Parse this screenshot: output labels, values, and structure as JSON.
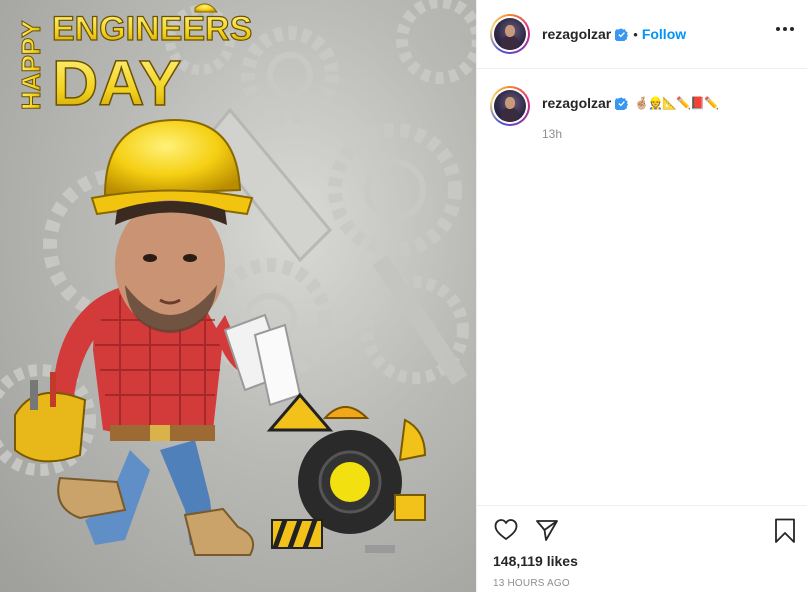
{
  "post": {
    "username": "rezagolzar",
    "follow_label": "Follow",
    "separator": "•",
    "caption_emojis": "🤞🏼👷📐✏️📕✏️",
    "caption_time": "13h",
    "likes_text": "148,119 likes",
    "posted_ago": "13 HOURS AGO"
  },
  "image": {
    "title_happy": "HAPPY",
    "title_engineers": "ENGINEERS",
    "title_day": "DAY"
  },
  "icons": {
    "verified": "verified-badge-icon",
    "more": "more-options-icon",
    "like": "heart-icon",
    "share": "paper-plane-icon",
    "save": "bookmark-icon"
  },
  "colors": {
    "accent": "#0095f6",
    "text": "#262626",
    "muted": "#8e8e8e",
    "border": "#efefef",
    "title_yellow": "#f2d21e"
  }
}
